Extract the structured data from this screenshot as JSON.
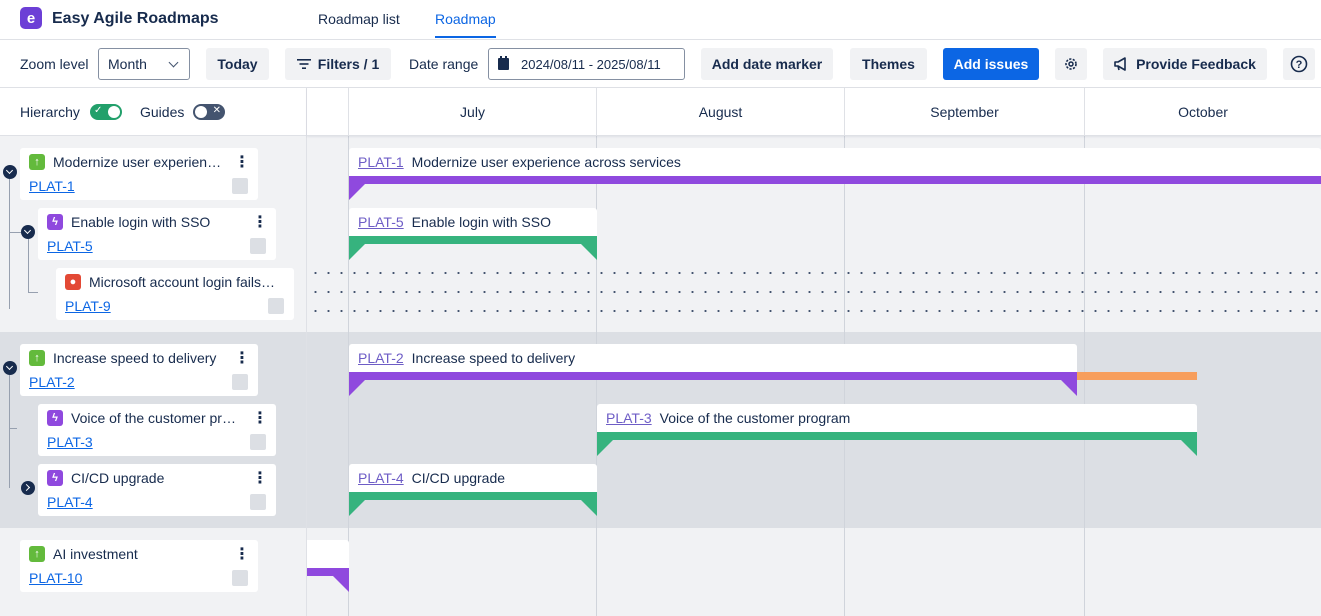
{
  "app": {
    "logo_letter": "e",
    "title": "Easy Agile Roadmaps"
  },
  "nav": {
    "tabs": [
      {
        "label": "Roadmap list",
        "active": false
      },
      {
        "label": "Roadmap",
        "active": true
      }
    ]
  },
  "toolbar": {
    "zoom_label": "Zoom level",
    "zoom_value": "Month",
    "today": "Today",
    "filters": "Filters / 1",
    "date_range_label": "Date range",
    "date_range_value": "2024/08/11 - 2025/08/11",
    "add_date_marker": "Add date marker",
    "themes": "Themes",
    "add_issues": "Add issues",
    "feedback": "Provide Feedback"
  },
  "view_options": {
    "hierarchy_label": "Hierarchy",
    "hierarchy_on": true,
    "guides_label": "Guides",
    "guides_on": false
  },
  "months": [
    "July",
    "August",
    "September",
    "October"
  ],
  "issues": [
    {
      "key": "PLAT-1",
      "summary": "Modernize user experien…",
      "bar_summary": "Modernize user experience across services",
      "type": "epic",
      "color": "#8f49de"
    },
    {
      "key": "PLAT-5",
      "summary": "Enable login with SSO",
      "bar_summary": "Enable login with SSO",
      "type": "story",
      "color": "#36b37e"
    },
    {
      "key": "PLAT-9",
      "summary": "Microsoft account login fails…",
      "type": "bug",
      "color": "#e34935"
    },
    {
      "key": "PLAT-2",
      "summary": "Increase speed to delivery",
      "bar_summary": "Increase speed to delivery",
      "type": "epic",
      "color": "#8f49de"
    },
    {
      "key": "PLAT-3",
      "summary": "Voice of the customer pr…",
      "bar_summary": "Voice of the customer program",
      "type": "story",
      "color": "#36b37e"
    },
    {
      "key": "PLAT-4",
      "summary": "CI/CD upgrade",
      "bar_summary": "CI/CD upgrade",
      "type": "story",
      "color": "#36b37e"
    },
    {
      "key": "PLAT-10",
      "summary": "AI investment",
      "type": "epic",
      "color": "#8f49de"
    }
  ],
  "colors": {
    "accent": "#0c66e4",
    "epic": "#8f49de",
    "story": "#36b37e",
    "bug": "#e34935",
    "overflow": "#f79e5c",
    "toggle_on": "#22a06b"
  }
}
